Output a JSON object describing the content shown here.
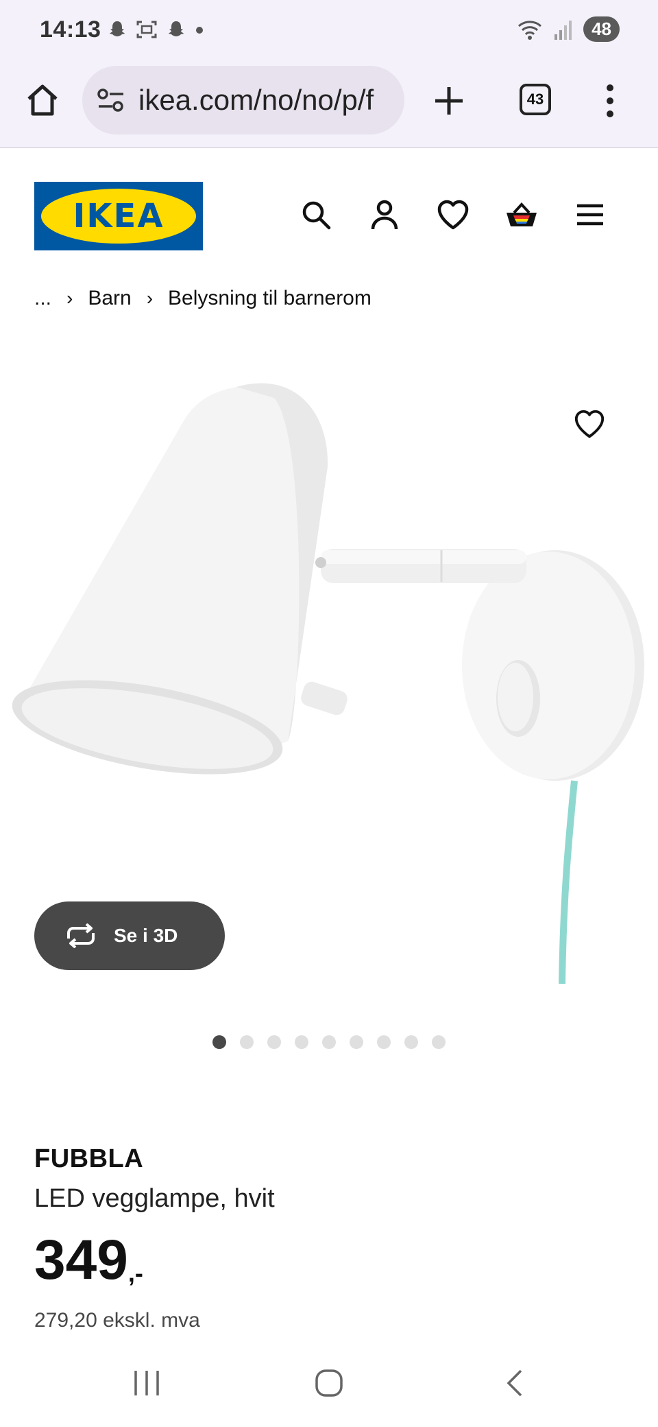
{
  "status_bar": {
    "time": "14:13",
    "battery": "48",
    "icons_left": [
      "snapchat-icon",
      "screenshot-icon",
      "snapchat-icon",
      "dot-icon"
    ],
    "icons_right": [
      "wifi-icon",
      "signal-icon"
    ]
  },
  "browser": {
    "url": "ikea.com/no/no/p/f",
    "tab_count": "43"
  },
  "header": {
    "logo_text": "IKEA",
    "icons": [
      "search-icon",
      "profile-icon",
      "heart-icon",
      "basket-icon",
      "menu-icon"
    ]
  },
  "breadcrumb": {
    "items": [
      "...",
      "Barn",
      "Belysning til barnerom"
    ]
  },
  "media": {
    "view_3d_label": "Se i 3D",
    "slide_count": 9,
    "active_slide": 0
  },
  "product": {
    "name": "FUBBLA",
    "description": "LED vegglampe, hvit",
    "price": "349",
    "price_suffix": ",-",
    "price_ex_vat": "279,20 ekskl. mva"
  },
  "colors": {
    "ikea_blue": "#0058a3",
    "ikea_yellow": "#ffdb00",
    "cord": "#8fd8d0",
    "dark_button": "#484848"
  }
}
